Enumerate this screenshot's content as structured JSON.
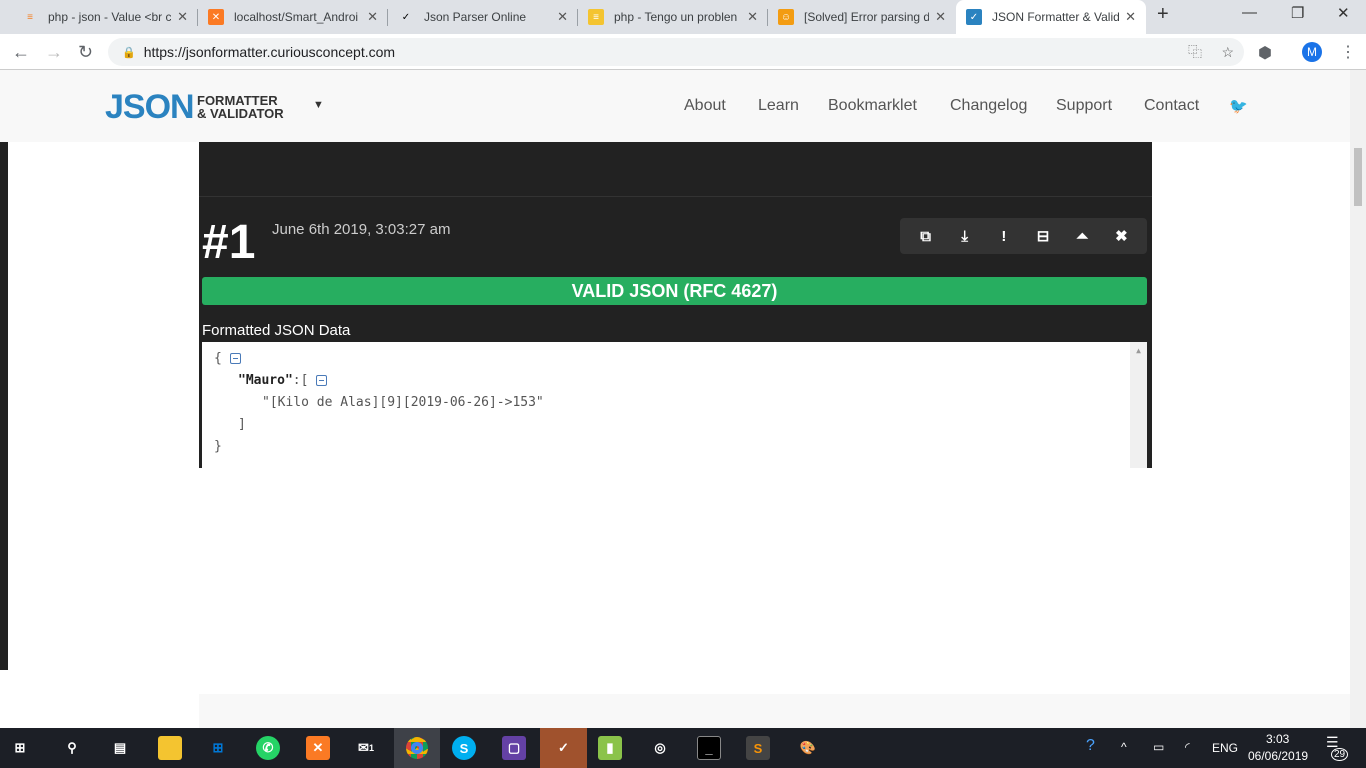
{
  "browser": {
    "tabs": [
      {
        "title": "php - json - Value <br c",
        "icon": "stackoverflow-icon",
        "color": "#f48024"
      },
      {
        "title": "localhost/Smart_Androi",
        "icon": "xampp-icon",
        "color": "#fb7a24"
      },
      {
        "title": "Json Parser Online",
        "icon": "json-check-icon",
        "color": "#ffffff"
      },
      {
        "title": "php - Tengo un problen",
        "icon": "stackoverflow-es-icon",
        "color": "#f4c430"
      },
      {
        "title": "[Solved] Error parsing d",
        "icon": "robot-icon",
        "color": "#f39c12"
      },
      {
        "title": "JSON Formatter & Valid",
        "icon": "checkbox-icon",
        "color": "#2b83c0",
        "active": true
      }
    ],
    "new_tab": "+",
    "url": "https://jsonformatter.curiousconcept.com",
    "profile_initial": "M"
  },
  "site": {
    "logo_main": "JSON",
    "logo_sub1": "FORMATTER",
    "logo_sub2": "& VALIDATOR",
    "menu": [
      "About",
      "Learn",
      "Bookmarklet",
      "Changelog",
      "Support",
      "Contact"
    ],
    "accent": "#2b83c0"
  },
  "result": {
    "number": "#1",
    "timestamp": "June 6th 2019, 3:03:27 am",
    "status": "VALID JSON (RFC 4627)",
    "status_color": "#27ae60",
    "formatted_label": "Formatted JSON Data",
    "code": {
      "open": "{",
      "key": "\"Mauro\"",
      "colon": ":[",
      "value": "\"[Kilo de Alas][9][2019-06-26]->153\"",
      "close_arr": "]",
      "close_obj": "}"
    }
  },
  "taskbar": {
    "language": "ENG",
    "time": "3:03",
    "date": "06/06/2019",
    "notifications": "29",
    "mail_badge": "1"
  }
}
